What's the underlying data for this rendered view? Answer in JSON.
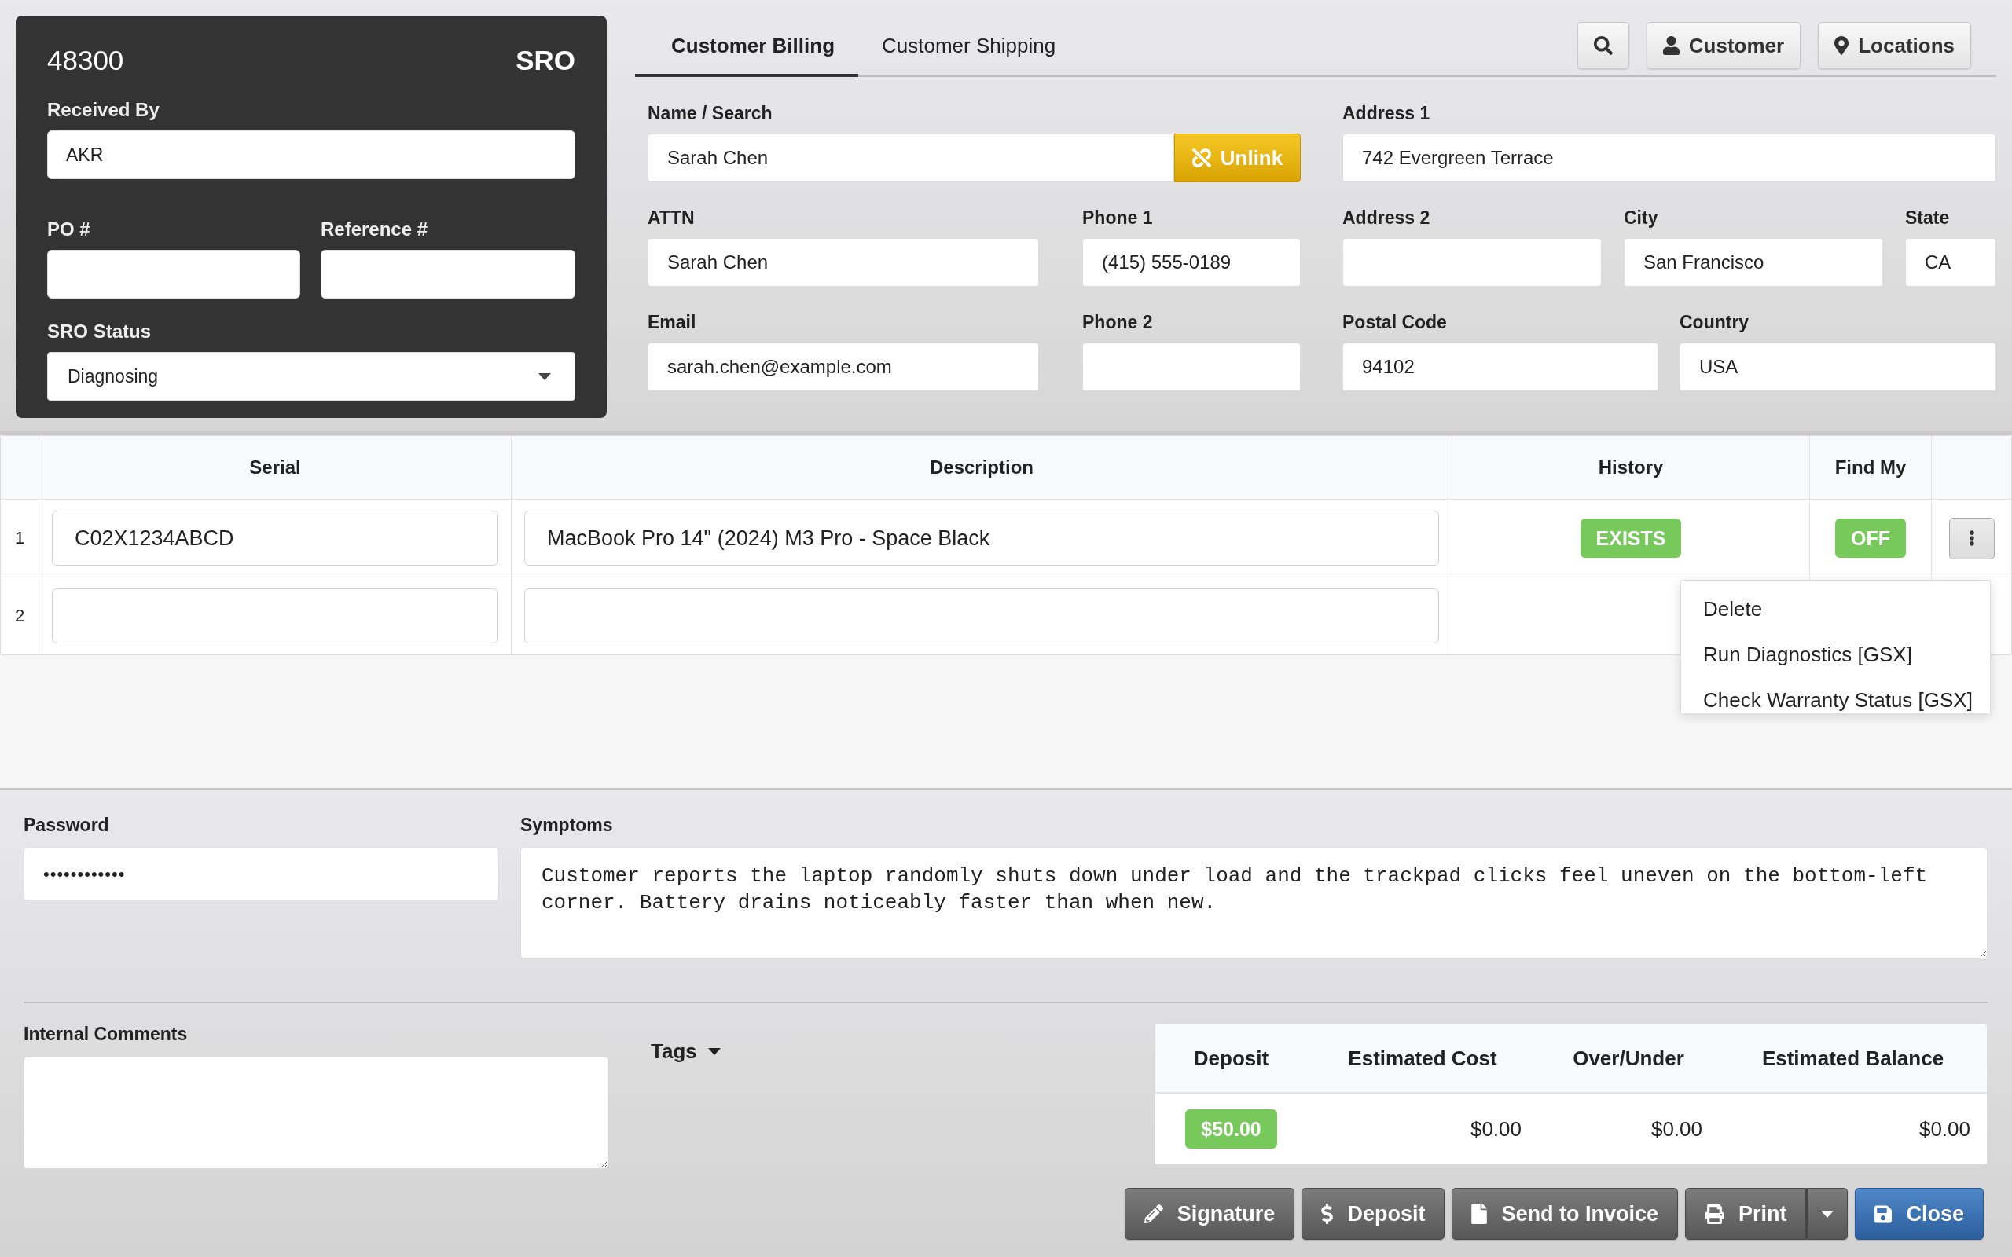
{
  "sro_panel": {
    "number": "48300",
    "type": "SRO",
    "received_by": {
      "label": "Received By",
      "value": "AKR"
    },
    "po_number": {
      "label": "PO #"
    },
    "reference_number": {
      "label": "Reference #"
    },
    "status": {
      "label": "SRO Status",
      "value": "Diagnosing"
    }
  },
  "customer": {
    "tabs": [
      {
        "label": "Customer Billing",
        "selected": true
      },
      {
        "label": "Customer Shipping",
        "selected": false
      }
    ],
    "toolbar": [
      {
        "kind": "search"
      },
      {
        "kind": "person",
        "label": "Customer"
      },
      {
        "kind": "pin",
        "label": "Locations"
      }
    ],
    "billing": {
      "name_search": {
        "label": "Name / Search",
        "value": "Sarah Chen",
        "button": "Unlink"
      },
      "attn": {
        "label": "ATTN",
        "value": "Sarah Chen"
      },
      "phone_1": {
        "label": "Phone 1",
        "value": "(415) 555-0189"
      },
      "email": {
        "label": "Email",
        "value": "sarah.chen@example.com"
      },
      "phone_2": {
        "label": "Phone 2"
      },
      "address_1": {
        "label": "Address 1",
        "value": "742 Evergreen Terrace"
      },
      "address_2": {
        "label": "Address 2"
      },
      "city": {
        "label": "City",
        "value": "San Francisco"
      },
      "state": {
        "label": "State",
        "value": "CA"
      },
      "postal_code": {
        "label": "Postal Code",
        "value": "94102"
      },
      "country": {
        "label": "Country",
        "value": "USA"
      }
    }
  },
  "items_table": {
    "columns": [
      "Serial",
      "Description",
      "History",
      "Find My"
    ],
    "rows": [
      {
        "number": "1",
        "serial": "C02X1234ABCD",
        "description": "MacBook Pro 14\" (2024) M3 Pro - Space Black",
        "history": "EXISTS",
        "find_my": "OFF",
        "menu_button": true
      },
      {
        "number": "2",
        "menu_button": false
      }
    ],
    "row_menu": [
      "Delete",
      "Run Diagnostics [GSX]",
      "Check Warranty Status [GSX]"
    ]
  },
  "details": {
    "password": {
      "label": "Password",
      "value": "••••••••••••"
    },
    "symptoms": {
      "label": "Symptoms",
      "value": "Customer reports the laptop randomly shuts down under load and the trackpad clicks feel uneven on the bottom-left corner. Battery drains noticeably faster than when new."
    },
    "internal_comments": {
      "label": "Internal Comments"
    },
    "tags": {
      "label": "Tags"
    }
  },
  "summary": {
    "columns": [
      "Deposit",
      "Estimated Cost",
      "Over/Under",
      "Estimated Balance"
    ],
    "cells": [
      {
        "kind": "badge",
        "value": "$50.00"
      },
      {
        "kind": "amount",
        "value": "$0.00"
      },
      {
        "kind": "amount",
        "value": "$0.00"
      },
      {
        "kind": "amount",
        "value": "$0.00"
      }
    ]
  },
  "actions": [
    {
      "kind": "signature",
      "label": "Signature",
      "primary": false,
      "split": false
    },
    {
      "kind": "deposit",
      "label": "Deposit",
      "primary": false,
      "split": false
    },
    {
      "kind": "invoice",
      "label": "Send to Invoice",
      "primary": false,
      "split": false
    },
    {
      "kind": "print",
      "label": "Print",
      "primary": false,
      "split": true
    },
    {
      "kind": "save",
      "label": "Close",
      "primary": true,
      "split": false
    }
  ]
}
